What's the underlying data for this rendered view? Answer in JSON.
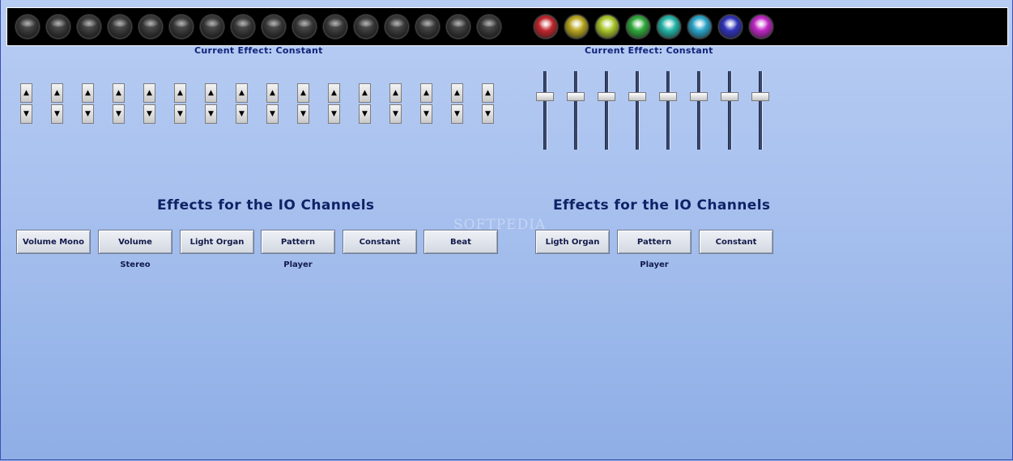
{
  "led_bar": {
    "left_leds": [
      "off",
      "off",
      "off",
      "off",
      "off",
      "off",
      "off",
      "off",
      "off",
      "off",
      "off",
      "off",
      "off",
      "off",
      "off",
      "off"
    ],
    "right_leds": [
      {
        "name": "red",
        "color": "#c0262c"
      },
      {
        "name": "yellow",
        "color": "#b9a51e"
      },
      {
        "name": "lime",
        "color": "#a9c52a"
      },
      {
        "name": "green",
        "color": "#2fa83a"
      },
      {
        "name": "cyan",
        "color": "#24b4a6"
      },
      {
        "name": "sky",
        "color": "#2aa5c9"
      },
      {
        "name": "blue",
        "color": "#2f32b8"
      },
      {
        "name": "magenta",
        "color": "#c026c4"
      }
    ]
  },
  "left_panel": {
    "current_effect": "Current Effect: Constant",
    "title": "Effects for the IO Channels",
    "channel_count": 16,
    "buttons": [
      "Volume Mono",
      "Volume Stereo",
      "Light Organ",
      "Pattern Player",
      "Constant",
      "Beat"
    ]
  },
  "right_panel": {
    "current_effect": "Current Effect: Constant",
    "title": "Effects for the IO Channels",
    "slider_levels": [
      0.7,
      0.7,
      0.7,
      0.7,
      0.7,
      0.7,
      0.7,
      0.7
    ],
    "buttons": [
      "Ligth Organ",
      "Pattern Player",
      "Constant"
    ]
  },
  "watermark": "SOFTPEDIA"
}
